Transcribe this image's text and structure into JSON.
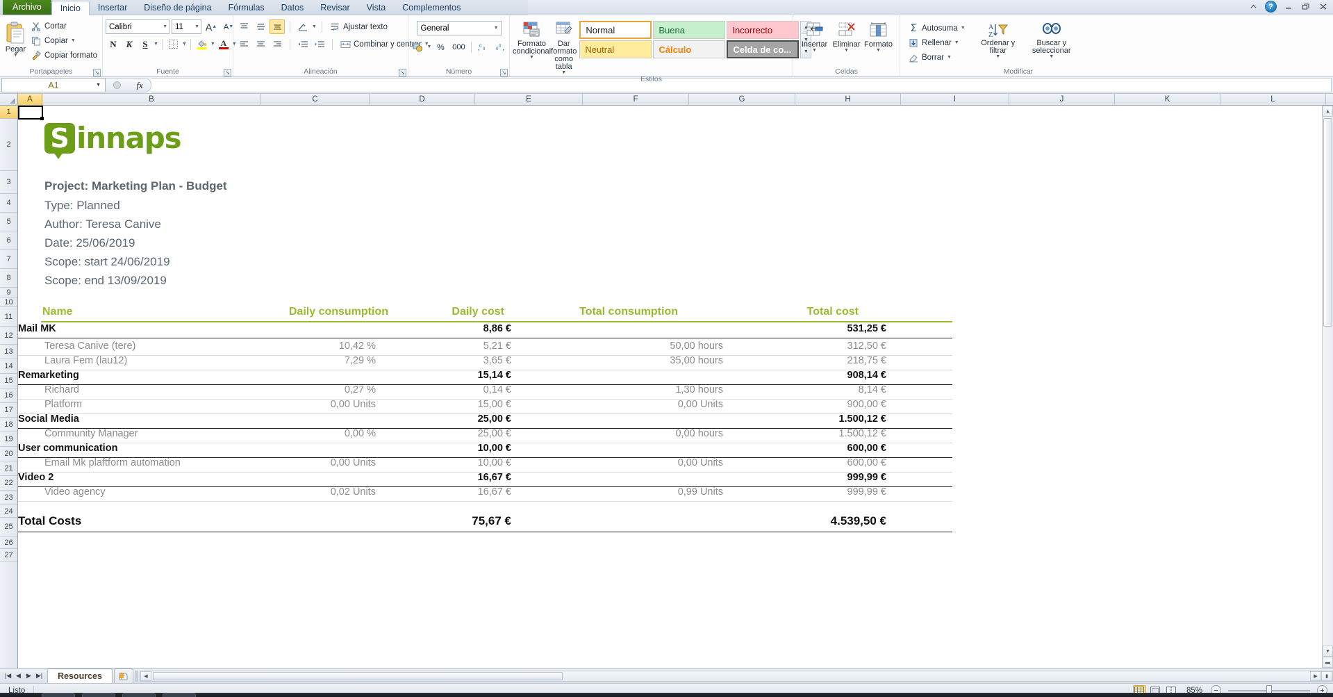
{
  "window": {
    "help_icon": "help-icon",
    "minimize_icon": "minimize-icon",
    "restore_icon": "restore-icon",
    "close_icon": "close-icon",
    "collapse_ribbon_icon": "chevron-up-icon"
  },
  "tabs": [
    {
      "label": "Archivo",
      "name": "tab-archivo"
    },
    {
      "label": "Inicio",
      "name": "tab-inicio"
    },
    {
      "label": "Insertar",
      "name": "tab-insertar"
    },
    {
      "label": "Diseño de página",
      "name": "tab-diseno-de-pagina"
    },
    {
      "label": "Fórmulas",
      "name": "tab-formulas"
    },
    {
      "label": "Datos",
      "name": "tab-datos"
    },
    {
      "label": "Revisar",
      "name": "tab-revisar"
    },
    {
      "label": "Vista",
      "name": "tab-vista"
    },
    {
      "label": "Complementos",
      "name": "tab-complementos"
    }
  ],
  "ribbon": {
    "clipboard": {
      "title": "Portapapeles",
      "paste": "Pegar",
      "cut": "Cortar",
      "copy": "Copiar",
      "format_painter": "Copiar formato"
    },
    "font": {
      "title": "Fuente",
      "font_name": "Calibri",
      "font_size": "11",
      "grow_label": "A",
      "shrink_label": "A",
      "bold": "N",
      "italic": "K",
      "underline": "S"
    },
    "alignment": {
      "title": "Alineación",
      "wrap_text": "Ajustar texto",
      "merge_center": "Combinar y centrar"
    },
    "number": {
      "title": "Número",
      "format": "General",
      "percent": "%",
      "thousands": "000"
    },
    "styles": {
      "title": "Estilos",
      "conditional_format": "Formato condicional",
      "format_as_table": "Dar formato como tabla",
      "gallery": [
        {
          "label": "Normal",
          "name": "style-normal"
        },
        {
          "label": "Buena",
          "name": "style-buena"
        },
        {
          "label": "Incorrecto",
          "name": "style-incorrecto"
        },
        {
          "label": "Neutral",
          "name": "style-neutral"
        },
        {
          "label": "Cálculo",
          "name": "style-calculo"
        },
        {
          "label": "Celda de co...",
          "name": "style-celda-de-comprobacion"
        }
      ]
    },
    "cells": {
      "title": "Celdas",
      "insert": "Insertar",
      "delete": "Eliminar",
      "format": "Formato"
    },
    "editing": {
      "title": "Modificar",
      "autosum": "Autosuma",
      "fill": "Rellenar",
      "clear": "Borrar",
      "sort_filter": "Ordenar y filtrar",
      "find_select": "Buscar y seleccionar"
    }
  },
  "formula_bar": {
    "name_box": "A1",
    "formula_value": "",
    "fx_label": "fx"
  },
  "grid": {
    "columns": [
      "A",
      "B",
      "C",
      "D",
      "E",
      "F",
      "G",
      "H",
      "I",
      "J",
      "K",
      "L"
    ],
    "rows": [
      "1",
      "2",
      "3",
      "4",
      "5",
      "6",
      "7",
      "8",
      "9",
      "10",
      "11",
      "12",
      "13",
      "14",
      "15",
      "16",
      "17",
      "18",
      "19",
      "20",
      "21",
      "22",
      "23",
      "24",
      "25",
      "26",
      "27"
    ],
    "selected_cell": "A1",
    "selected_column": "A",
    "selected_row": "1"
  },
  "sheet": {
    "logo": {
      "mark": "S",
      "word": "innaps",
      "color": "#6d9e18"
    },
    "meta": [
      "Project: Marketing Plan - Budget",
      "Type: Planned",
      "Author: Teresa Canive",
      "Date: 25/06/2019",
      "Scope: start 24/06/2019",
      "Scope: end 13/09/2019"
    ],
    "table": {
      "headers": [
        "Name",
        "Daily consumption",
        "Daily cost",
        "Total consumption",
        "Total cost"
      ],
      "rows": [
        {
          "type": "group",
          "name": "Mail MK",
          "daily_consumption": "",
          "daily_cost": "8,86 €",
          "total_consumption": "",
          "total_cost": "531,25 €"
        },
        {
          "type": "detail",
          "name": "Teresa Canive (tere)",
          "daily_consumption": "10,42 %",
          "daily_cost": "5,21 €",
          "total_consumption": "50,00 hours",
          "total_cost": "312,50 €"
        },
        {
          "type": "detail",
          "name": "Laura Fem (lau12)",
          "daily_consumption": "7,29 %",
          "daily_cost": "3,65 €",
          "total_consumption": "35,00 hours",
          "total_cost": "218,75 €"
        },
        {
          "type": "group",
          "name": "Remarketing",
          "daily_consumption": "",
          "daily_cost": "15,14 €",
          "total_consumption": "",
          "total_cost": "908,14 €"
        },
        {
          "type": "detail",
          "name": "Richard",
          "daily_consumption": "0,27 %",
          "daily_cost": "0,14 €",
          "total_consumption": "1,30 hours",
          "total_cost": "8,14 €"
        },
        {
          "type": "detail",
          "name": "Platform",
          "daily_consumption": "0,00 Units",
          "daily_cost": "15,00 €",
          "total_consumption": "0,00 Units",
          "total_cost": "900,00 €"
        },
        {
          "type": "group",
          "name": "Social Media",
          "daily_consumption": "",
          "daily_cost": "25,00 €",
          "total_consumption": "",
          "total_cost": "1.500,12 €"
        },
        {
          "type": "detail",
          "name": "Community Manager",
          "daily_consumption": "0,00 %",
          "daily_cost": "25,00 €",
          "total_consumption": "0,00 hours",
          "total_cost": "1.500,12 €"
        },
        {
          "type": "group",
          "name": "User communication",
          "daily_consumption": "",
          "daily_cost": "10,00 €",
          "total_consumption": "",
          "total_cost": "600,00 €"
        },
        {
          "type": "detail",
          "name": "Email Mk plaftform automation",
          "daily_consumption": "0,00 Units",
          "daily_cost": "10,00 €",
          "total_consumption": "0,00 Units",
          "total_cost": "600,00 €"
        },
        {
          "type": "group",
          "name": "Video 2",
          "daily_consumption": "",
          "daily_cost": "16,67 €",
          "total_consumption": "",
          "total_cost": "999,99 €"
        },
        {
          "type": "detail",
          "name": "Video agency",
          "daily_consumption": "0,02 Units",
          "daily_cost": "16,67 €",
          "total_consumption": "0,99 Units",
          "total_cost": "999,99 €"
        }
      ],
      "total": {
        "name": "Total Costs",
        "daily_cost": "75,67 €",
        "total_cost": "4.539,50 €"
      }
    }
  },
  "sheet_tabs": {
    "first_icon": "first-sheet-icon",
    "prev_icon": "prev-sheet-icon",
    "next_icon": "next-sheet-icon",
    "last_icon": "last-sheet-icon",
    "tabs": [
      {
        "label": "Resources",
        "name": "sheet-tab-resources"
      }
    ],
    "new_sheet_icon": "new-sheet-icon"
  },
  "status_bar": {
    "status": "Listo",
    "view_normal": "normal-view-icon",
    "view_layout": "page-layout-view-icon",
    "view_pagebreak": "page-break-view-icon",
    "zoom_level": "85%",
    "zoom_out": "−",
    "zoom_in": "+"
  }
}
